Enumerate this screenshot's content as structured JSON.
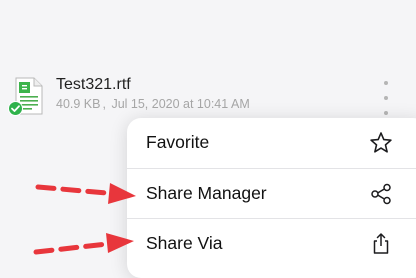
{
  "file": {
    "name": "Test321.rtf",
    "size": "40.9 KB",
    "separator": ",",
    "modified": "Jul 15, 2020 at 10:41 AM",
    "status": "synced",
    "icon": "rtf-document-icon",
    "status_icon": "green-check-icon"
  },
  "menu": {
    "items": [
      {
        "label": "Favorite",
        "icon": "star-icon"
      },
      {
        "label": "Share Manager",
        "icon": "share-nodes-icon"
      },
      {
        "label": "Share Via",
        "icon": "share-upload-icon"
      }
    ]
  },
  "annotations": {
    "arrow_color": "#e8363c",
    "arrows_point_to": [
      "Share Manager",
      "Share Via"
    ]
  },
  "colors": {
    "background": "#f5f5f7",
    "menu_background": "#ffffff",
    "doc_green": "#3cb44b",
    "meta_text": "#a6a6a6"
  }
}
